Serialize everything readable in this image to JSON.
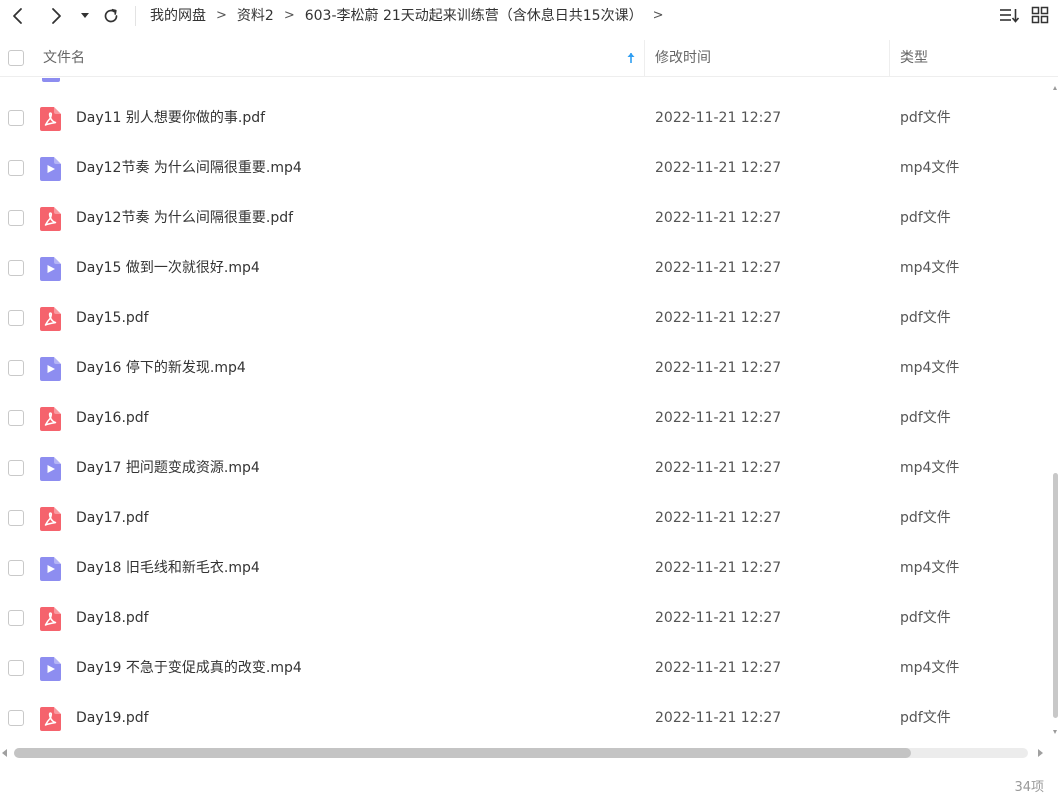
{
  "breadcrumb": {
    "items": [
      "我的网盘",
      "资料2",
      "603-李松蔚 21天动起来训练营（含休息日共15次课）"
    ],
    "separator": ">"
  },
  "columns": {
    "name": "文件名",
    "time": "修改时间",
    "type": "类型"
  },
  "colors": {
    "pdf_icon": "#f5636d",
    "mp4_icon": "#8d8df0",
    "sort_arrow": "#2f9ef2"
  },
  "files": [
    {
      "name": "Day11 别人想要你做的事.pdf",
      "time": "2022-11-21 12:27",
      "type": "pdf文件",
      "icon": "pdf-file-icon"
    },
    {
      "name": "Day12节奏 为什么间隔很重要.mp4",
      "time": "2022-11-21 12:27",
      "type": "mp4文件",
      "icon": "video-file-icon"
    },
    {
      "name": "Day12节奏 为什么间隔很重要.pdf",
      "time": "2022-11-21 12:27",
      "type": "pdf文件",
      "icon": "pdf-file-icon"
    },
    {
      "name": "Day15 做到一次就很好.mp4",
      "time": "2022-11-21 12:27",
      "type": "mp4文件",
      "icon": "video-file-icon"
    },
    {
      "name": "Day15.pdf",
      "time": "2022-11-21 12:27",
      "type": "pdf文件",
      "icon": "pdf-file-icon"
    },
    {
      "name": "Day16 停下的新发现.mp4",
      "time": "2022-11-21 12:27",
      "type": "mp4文件",
      "icon": "video-file-icon"
    },
    {
      "name": "Day16.pdf",
      "time": "2022-11-21 12:27",
      "type": "pdf文件",
      "icon": "pdf-file-icon"
    },
    {
      "name": "Day17 把问题变成资源.mp4",
      "time": "2022-11-21 12:27",
      "type": "mp4文件",
      "icon": "video-file-icon"
    },
    {
      "name": "Day17.pdf",
      "time": "2022-11-21 12:27",
      "type": "pdf文件",
      "icon": "pdf-file-icon"
    },
    {
      "name": "Day18 旧毛线和新毛衣.mp4",
      "time": "2022-11-21 12:27",
      "type": "mp4文件",
      "icon": "video-file-icon"
    },
    {
      "name": "Day18.pdf",
      "time": "2022-11-21 12:27",
      "type": "pdf文件",
      "icon": "pdf-file-icon"
    },
    {
      "name": "Day19 不急于变促成真的改变.mp4",
      "time": "2022-11-21 12:27",
      "type": "mp4文件",
      "icon": "video-file-icon"
    },
    {
      "name": "Day19.pdf",
      "time": "2022-11-21 12:27",
      "type": "pdf文件",
      "icon": "pdf-file-icon"
    }
  ],
  "footer": {
    "count": "34项"
  }
}
